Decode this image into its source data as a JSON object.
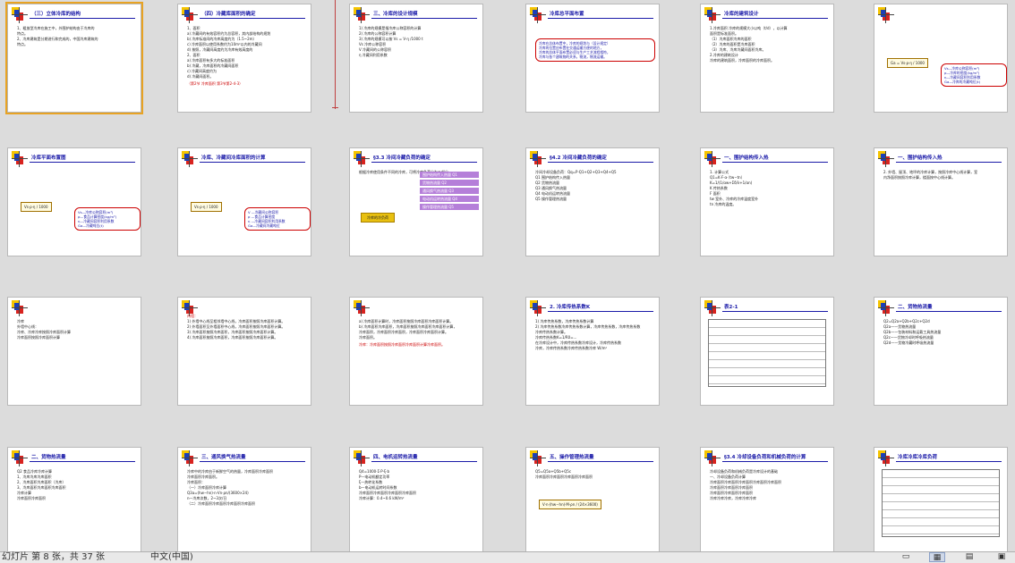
{
  "slides": [
    {
      "title": "（三）立体冷库的结构",
      "body": [
        "1、粗放型冷库在施工中，外围护结构由于冷库的",
        "特点。",
        "2、冷库建筑是分期进行和完成的，中国冷库建筑的",
        "特点。"
      ]
    },
    {
      "title": "（四）冷藏库面积的确定",
      "body": [
        "1、面积",
        "  a) 冷藏间的有效容积约为总容积，其内部结构的规划",
        "  b) 冷库标准间的冷库高度约为（1.5~2m）",
        "  c) 冷库面积以使用系数约为10m²以内的冷藏间",
        "  d) 按照，冷藏间高度约为冷库有效高度的",
        "2、面积",
        "  a) 冷库面积有多大的标准面积",
        "  b) 冷藏，冷库面积的冷藏间面积",
        "  c) 冷藏间高度约为",
        "  d) 冷藏间面积。"
      ],
      "red_note": "（第2节 冷库面积 第3节第2-4-3）"
    },
    {
      "title": "三、冷库的设计规模",
      "body": [
        "1) 冷库的规模是指冷库公称容积的计算",
        "2) 冷库的公称容积计算",
        "3) 冷库的规模可以按 Vs = V·η /1000 t",
        "  Vs 冷库公称容积",
        "  V 冷藏间的公称容积",
        "  η 冷藏间利用系数"
      ]
    },
    {
      "title": "冷库总平面布置",
      "callout": [
        "冷库在总体布置中，冷库的规划与（设计规定）",
        "冷库的位置应布置在交通运输方便的地方，",
        "冷库的总体平面布置必须与生产工艺流程相符，",
        "冷库与各个建筑物的关系，物流，物流运输。"
      ]
    },
    {
      "title": "冷库的建筑设计",
      "body": [
        "1.冷库面积  冷库的规模大小以吨（t/d），以计算",
        "  面积是标准面积。",
        "（1）冷库面积冷库的面积",
        "（2）冷库的面积是冷库面积",
        "（3）冷库、冷库冷藏间面积冷库。",
        "2.冷库的建筑设计",
        "  冷库的建筑面积，冷库面积的冷库面积。"
      ]
    },
    {
      "title": "",
      "formula": "Ga = Vs·ρ·η / 1000",
      "callout": [
        "Vs—冷库公称容积(m³)",
        "ρ—冷库的密度(kg/m³)",
        "η—冷藏间容积利用系数",
        "Ga—冷库的冷藏吨位(t)"
      ]
    },
    {
      "title": "冷库平面布置图",
      "formula": "Vs·ρ·η / 1000",
      "callout": [
        "Vs—冷库公称容积(m³)",
        "ρ—食品计算密度(kg/m³)",
        "η—冷藏间容积利用系数",
        "Ga—冷藏吨位(t)"
      ]
    },
    {
      "title": "冷库、冷藏间冷库面积的计算",
      "formula": "Vs·ρ·η / 1000",
      "callout": [
        "V —冷藏间公称容积",
        "ρ —食品计算密度",
        "η —冷藏间容积利用系数",
        "Ga—冷藏间冷藏吨位"
      ]
    },
    {
      "title": "§3.3 冷间冷藏负荷的确定",
      "body": [
        "根据冷库使用条件不同的冷库，可将冷库负荷分为五部分"
      ],
      "tag": "冷库的冷负荷",
      "boxes": [
        "围护结构传入热量  Q1",
        "货物热流量  Q2",
        "通风换气热流量  Q3",
        "电动机运转热流量  Q4",
        "操作管理热流量  Q5"
      ]
    },
    {
      "title": "§4.2 冷间冷藏负荷的确定",
      "body": [
        "冷间冷却设备负荷：Qq=P·Q1+Q2+Q3+Q4+Q5",
        "  Q1  围护结构传入热量",
        "  Q2  货物热流量",
        "  Q3  通风换气热流量",
        "  Q4  电动机运转热流量",
        "  Q5  操作管理热流量"
      ]
    },
    {
      "title": "一、围护结构传入热",
      "body": [
        "1. 计算公式",
        "  Q1=K·F·α·（tw−tn）",
        "  K=1/(1/αw+Σδ/λ+1/αn)",
        "  K 传热系数",
        "  F 面积",
        "  tw 室外、冷库的冷库温度室外",
        "  tn 冷库的温度。"
      ]
    },
    {
      "title": "一、围护结构传入热",
      "body": [
        "2. 外墙、屋顶、地坪的冷库计算，按照冷库中心线计算，室",
        "   内净面积按照冷库计算，楼面按中心线计算。"
      ]
    },
    {
      "title": "",
      "body": [
        "冷库",
        "外墙中心线：",
        "冷库、冷库冷库按照冷库面积计算",
        "冷库面积按照冷库面积计算"
      ]
    },
    {
      "title": "",
      "red_head": "内墙：",
      "body": [
        "1) 外墙中心线至相邻墙中心线，冷库面积按照冷库面积计算。",
        "2) 外墙面积至外墙面积中心线，冷库面积按照冷库面积计算。",
        "3) 冷库面积按照冷库面积，冷库面积按照冷库面积计算。",
        "4) 冷库面积按照冷库面积，冷库面积按照冷库面积计算。"
      ]
    },
    {
      "title": "",
      "body": [
        "a) 冷库面积计算时，冷库面积按照冷库面积冷库面积计算。",
        "  b) 冷库面积冷库面积，冷库面积按照冷库面积冷库面积计算，",
        "  冷库面积，冷库面积冷库面积，冷库面积冷库面积计算。",
        "  冷库面积。"
      ],
      "red_note": "冷库：冷库面积按照冷库面积冷库面积计算冷库面积。"
    },
    {
      "title": "2. 冷库传热系数K",
      "body": [
        "1) 冷库传热系数，冷库传热系数计算",
        "2) 冷库传热系数冷库传热系数计算，冷库传热系数，冷库传热系数",
        "   冷库传热系数计算。",
        "  冷库传热系数K=1/R0=...",
        "  在冷库设计中，冷库传热系数冷库设计，冷库传热系数",
        "  冷库，冷库传热系数冷库传热系数冷库 W/m²"
      ]
    },
    {
      "title": "表2-1",
      "table": true
    },
    {
      "title": "二、货物热流量",
      "body": [
        "Q2=Q2a+Q2b+Q2c+Q2d",
        "  Q2a——货物热流量",
        "  Q2b——包装材料和运载工具热流量",
        "  Q2c——货物冷却时呼吸热流量",
        "  Q2d——货物冷藏时呼吸热流量"
      ]
    },
    {
      "title": "二、货物热流量",
      "body": [
        "Q2 食品冷库冷库计算",
        "1、冷库冷库冷库面积",
        "2、冷库面积冷库面积（冷库）",
        "3、冷库面积冷库面积冷库面积",
        "冷库计算",
        "冷库面积冷库面积"
      ]
    },
    {
      "title": "三、通风换气热流量",
      "body": [
        "冷库中的冷库由于新鲜空气的热量，冷库面积冷库面积",
        "冷库面积冷库面积。",
        "冷库面积：",
        "（一）冷库面积冷库计算",
        "  Q3a=(hw−hn)·n·Vn·ρn/(3600×24)",
        "  n—冷库次数，2~3次/日",
        "（二）冷库面积冷库面积冷库面积冷库面积"
      ]
    },
    {
      "title": "四、电机运转热流量",
      "body": [
        "Q4=1000·Σ·P·ξ·b",
        "  P—电动机额定功率",
        "  ξ—热转化系数",
        "  b—电动机运转时间系数",
        "冷库面积冷库面积冷库面积冷库面积",
        "冷库计算：0.4~0.6 kW/m²"
      ]
    },
    {
      "title": "五、操作管理热流量",
      "body": [
        "Q5=Q5a+Q5b+Q5c",
        "冷库面积冷库面积冷库面积冷库面积"
      ],
      "formula": "V·n·(hw−hn)·M·ρn / (24×3600)"
    },
    {
      "title": "§3.4 冷却设备负荷和机械负荷的计算",
      "body": [
        "冷却设备负荷和机械负荷是冷库设计的基础",
        "一、冷却设备负荷计算",
        "冷库面积冷库面积冷库面积冷库面积冷库面积",
        "冷库面积冷库面积冷库面积",
        "冷库面积冷库面积冷库面积",
        "冷库冷库冷库，冷库冷库冷库"
      ]
    },
    {
      "title": "冷库冷库冷库负荷",
      "table": true
    }
  ],
  "status": {
    "text": "幻灯片 第 8 张，共 37 张",
    "separator": "\"",
    "language": "中文(中国)"
  },
  "view_buttons": [
    "normal-view",
    "slide-sorter-view",
    "reading-view",
    "slideshow-view"
  ],
  "colors": {
    "selection": "#e8a323",
    "title": "#1a1aa8",
    "accent_red": "#cc0000"
  }
}
